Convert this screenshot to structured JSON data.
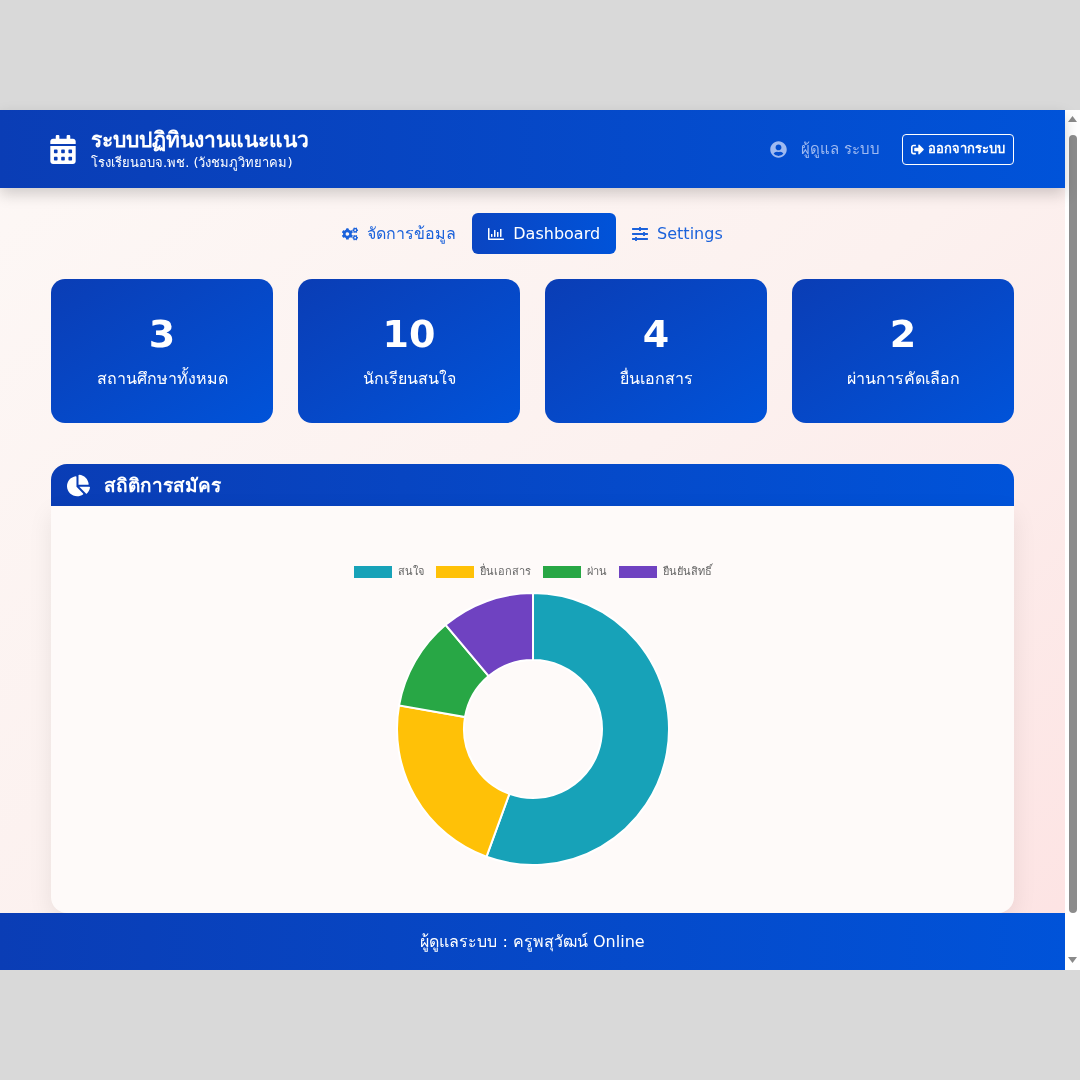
{
  "header": {
    "title": "ระบบปฏิทินงานแนะแนว",
    "subtitle": "โรงเรียนอบจ.พช. (วังชมภูวิทยาคม)",
    "user": "ผู้ดูแล ระบบ",
    "logout_button": "ออกจากระบบ"
  },
  "tabs": [
    {
      "label": "จัดการข้อมูล",
      "selected": false
    },
    {
      "label": "Dashboard",
      "selected": true
    },
    {
      "label": "Settings",
      "selected": false
    }
  ],
  "stats": [
    {
      "value": "3",
      "label": "สถานศึกษาทั้งหมด"
    },
    {
      "value": "10",
      "label": "นักเรียนสนใจ"
    },
    {
      "value": "4",
      "label": "ยื่นเอกสาร"
    },
    {
      "value": "2",
      "label": "ผ่านการคัดเลือก"
    }
  ],
  "chart_panel": {
    "title": "สถิติการสมัคร",
    "chart_data": {
      "type": "donut",
      "legend": "top",
      "categories": [
        "สนใจ",
        "ยื่นเอกสาร",
        "ผ่าน",
        "ยืนยันสิทธิ์"
      ],
      "colors": [
        "#17a2b8",
        "#ffc107",
        "#28a745",
        "#6f42c1"
      ],
      "series": [
        {
          "values": [
            55.56,
            22.22,
            11.11,
            11.11
          ]
        }
      ]
    }
  },
  "footer": "ผู้ดูแลระบบ : ครูพสุวัฒน์ Online"
}
